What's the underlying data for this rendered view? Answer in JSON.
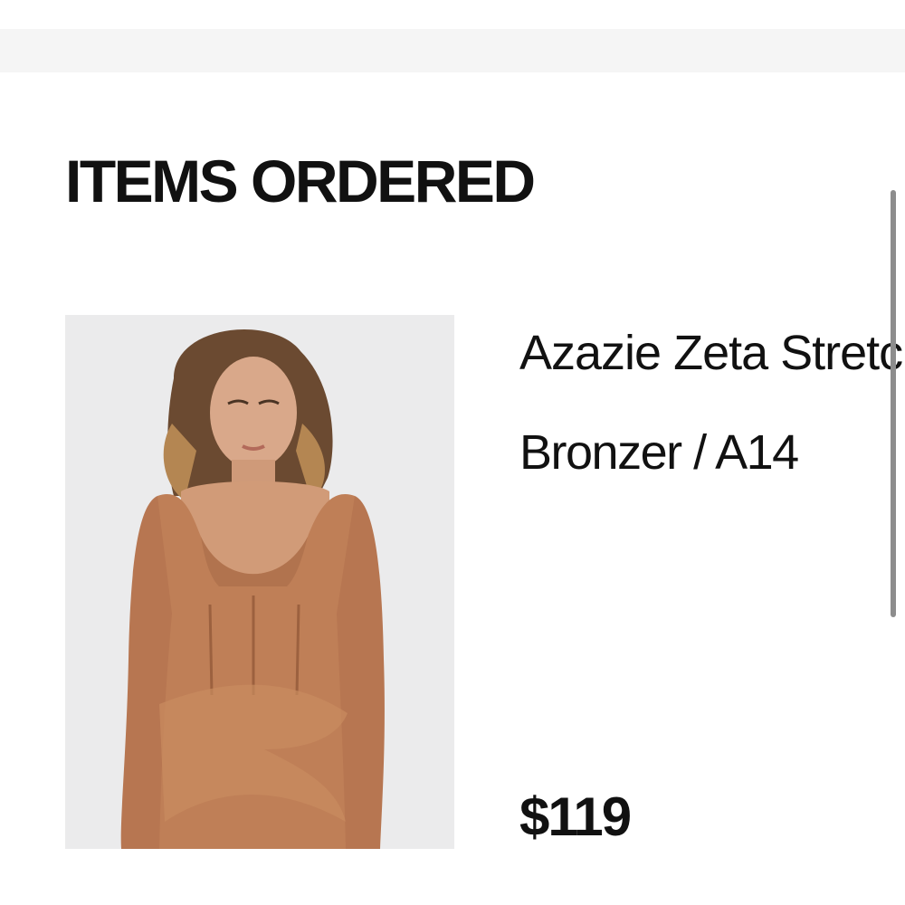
{
  "section": {
    "title": "ITEMS ORDERED"
  },
  "order_item": {
    "name": "Azazie Zeta Stretch",
    "variant": "Bronzer / A14",
    "price": "$119",
    "image_alt": "product-photo-dress",
    "colors": {
      "dress": "#bf7f57",
      "background": "#ebebec"
    }
  }
}
